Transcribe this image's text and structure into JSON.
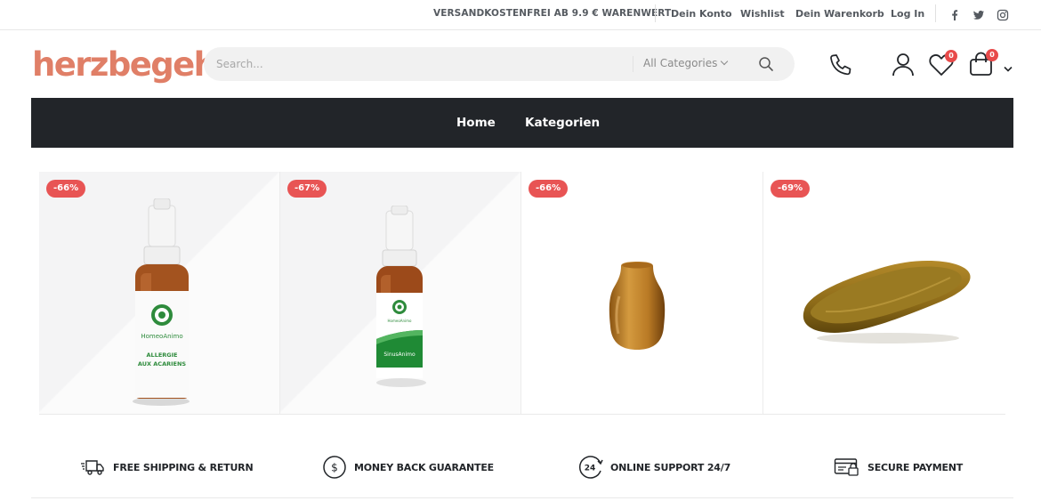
{
  "topbar": {
    "promo": "VERSANDKOSTENFREI AB 9.9 € WARENWERT",
    "links": [
      "Dein Konto",
      "Wishlist",
      "Dein Warenkorb",
      "Log In"
    ],
    "social": [
      "facebook-icon",
      "twitter-icon",
      "instagram-icon"
    ]
  },
  "header": {
    "logo": "herzbegehrt",
    "search_placeholder": "Search...",
    "category": "All Categories",
    "wishlist_count": "0",
    "cart_count": "0"
  },
  "nav": {
    "items": [
      "Home",
      "Kategorien"
    ]
  },
  "products": [
    {
      "discount": "-66%",
      "label_brand": "HomeoAnimo",
      "label_line1": "ALLERGIE",
      "label_line2": "AUX ACARIENS"
    },
    {
      "discount": "-67%",
      "label_brand": "HomeoAnimo",
      "label_name": "SinusAnimo"
    },
    {
      "discount": "-66%"
    },
    {
      "discount": "-69%"
    }
  ],
  "features": [
    {
      "label": "FREE SHIPPING & RETURN",
      "icon": "truck-icon"
    },
    {
      "label": "MONEY BACK GUARANTEE",
      "icon": "dollar-icon"
    },
    {
      "label": "ONLINE SUPPORT 24/7",
      "icon": "support-24-icon"
    },
    {
      "label": "SECURE PAYMENT",
      "icon": "secure-payment-icon"
    }
  ],
  "colors": {
    "brand": "#e07f67",
    "nav_bg": "#222529",
    "sale_badge": "#e85454",
    "count_badge": "#e84a4a"
  }
}
